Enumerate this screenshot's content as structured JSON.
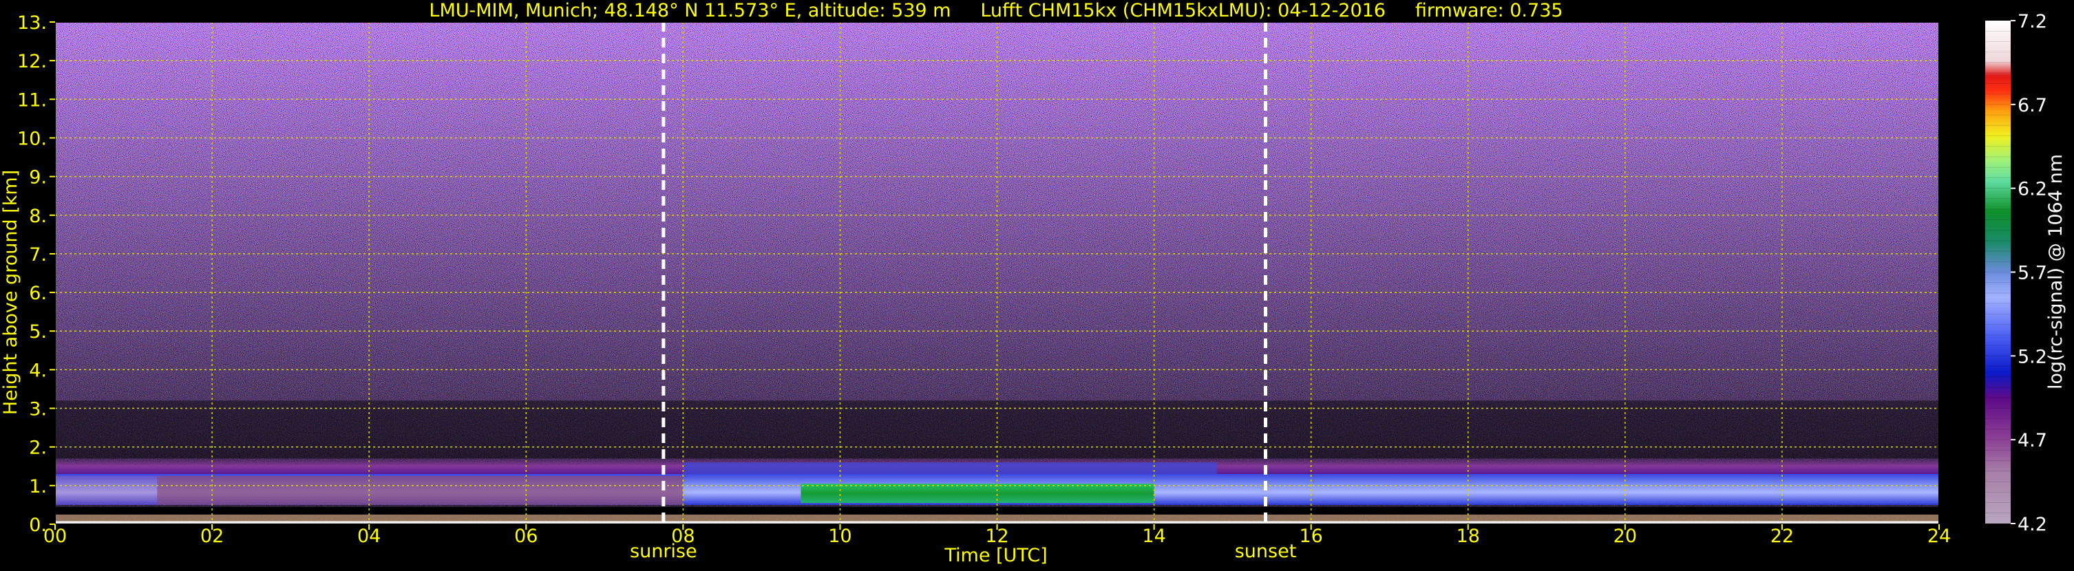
{
  "chart_data": {
    "type": "heatmap",
    "title": "LMU-MIM, Munich; 48.148° N 11.573° E, altitude: 539 m     Lufft CHM15kx (CHM15kxLMU): 04-12-2016     firmware: 0.735",
    "xlabel": "Time [UTC]",
    "ylabel": "Height above ground [km]",
    "xlim": [
      0,
      24
    ],
    "ylim": [
      0,
      13
    ],
    "x_ticks": [
      "00",
      "02",
      "04",
      "06",
      "08",
      "10",
      "12",
      "14",
      "16",
      "18",
      "20",
      "22",
      "24"
    ],
    "y_ticks": [
      "0.",
      "1.",
      "2.",
      "3.",
      "4.",
      "5.",
      "6.",
      "7.",
      "8.",
      "9.",
      "10.",
      "11.",
      "12.",
      "13."
    ],
    "grid": true,
    "colorbar": {
      "label": "log(rc-signal) @ 1064 nm",
      "range": [
        4.2,
        7.2
      ],
      "ticks": [
        "4.2",
        "4.7",
        "5.2",
        "5.7",
        "6.2",
        "6.7",
        "7.2"
      ]
    },
    "markers": [
      {
        "label": "sunrise",
        "time_utc": 7.75
      },
      {
        "label": "sunset",
        "time_utc": 15.42
      }
    ],
    "layers": {
      "boundary_layer_top_km": 1.5,
      "mixed_layer_band_km": [
        0.5,
        1.3
      ],
      "high_signal_period_utc": [
        9.5,
        14.0
      ]
    },
    "colors": {
      "text": "#ffff00",
      "grid": "#d8d800",
      "marker_line": "#ffffff",
      "background": "#000000"
    }
  }
}
